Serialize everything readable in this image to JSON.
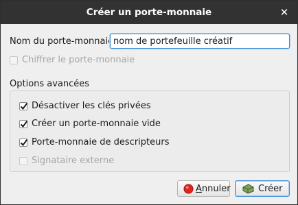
{
  "dialog": {
    "title": "Créer un porte-monnaie",
    "close_glyph": "✕"
  },
  "wallet_name": {
    "label": "Nom du porte-monnaie",
    "value": "nom de portefeuille créatif"
  },
  "encrypt": {
    "label": "Chiffrer le porte-monnaie",
    "checked": false,
    "enabled": false
  },
  "advanced": {
    "title": "Options avancées",
    "options": [
      {
        "label": "Désactiver les clés privées",
        "checked": true,
        "enabled": true
      },
      {
        "label": "Créer un porte-monnaie vide",
        "checked": true,
        "enabled": true
      },
      {
        "label": "Porte-monnaie de descripteurs",
        "checked": true,
        "enabled": true
      },
      {
        "label": "Signataire externe",
        "checked": false,
        "enabled": false
      }
    ]
  },
  "buttons": {
    "cancel": {
      "underline_char": "A",
      "rest": "nnuler",
      "icon": "cancel-icon"
    },
    "create": {
      "label": "Créer",
      "icon": "wallet-create-icon"
    }
  },
  "colors": {
    "titlebar": "#323232",
    "focus_accent": "#3b8fd6",
    "cancel_icon_red": "#e0251b"
  }
}
